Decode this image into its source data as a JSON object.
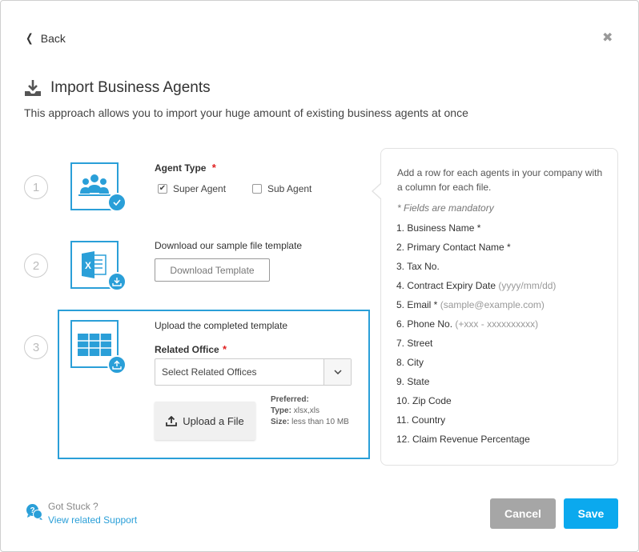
{
  "nav": {
    "back_label": "Back",
    "close_glyph": "✖"
  },
  "header": {
    "title": "Import Business Agents",
    "subtitle": "This approach allows you to import your huge amount of existing business agents at once"
  },
  "steps": [
    {
      "number": "1",
      "icon": "agents-group-icon"
    },
    {
      "number": "2",
      "icon": "excel-file-icon"
    },
    {
      "number": "3",
      "icon": "table-grid-icon"
    }
  ],
  "step1": {
    "label": "Agent Type",
    "required_mark": "*",
    "options": [
      {
        "label": "Super Agent",
        "checked": true
      },
      {
        "label": "Sub Agent",
        "checked": false
      }
    ]
  },
  "step2": {
    "label": "Download our sample file template",
    "button_label": "Download Template"
  },
  "step3": {
    "label": "Upload the completed template",
    "office_label": "Related Office",
    "required_mark": "*",
    "select_value": "Select Related Offices",
    "upload_label": "Upload a File",
    "preferred_label": "Preferred:",
    "type_label": "Type:",
    "type_value": "xlsx,xls",
    "size_label": "Size:",
    "size_value": "less than 10 MB"
  },
  "info": {
    "intro": "Add a row for each agents in your company with a column for each file.",
    "mandatory_note": "* Fields are mandatory",
    "fields": [
      {
        "text": "1. Business Name *",
        "hint": ""
      },
      {
        "text": "2. Primary Contact Name *",
        "hint": ""
      },
      {
        "text": "3. Tax No.",
        "hint": ""
      },
      {
        "text": "4. Contract Expiry Date",
        "hint": "(yyyy/mm/dd)"
      },
      {
        "text": "5. Email *",
        "hint": "(sample@example.com)"
      },
      {
        "text": "6. Phone No.",
        "hint": "(+xxx - xxxxxxxxxx)"
      },
      {
        "text": "7. Street",
        "hint": ""
      },
      {
        "text": "8. City",
        "hint": ""
      },
      {
        "text": "9. State",
        "hint": ""
      },
      {
        "text": "10. Zip Code",
        "hint": ""
      },
      {
        "text": "11. Country",
        "hint": ""
      },
      {
        "text": "12. Claim Revenue Percentage",
        "hint": ""
      }
    ]
  },
  "footer": {
    "help_title": "Got Stuck ?",
    "help_link": "View related Support",
    "cancel_label": "Cancel",
    "save_label": "Save"
  },
  "colors": {
    "accent": "#2a9fd8",
    "save": "#0ba9ee",
    "cancel": "#a6a6a6",
    "required": "#e02020"
  }
}
